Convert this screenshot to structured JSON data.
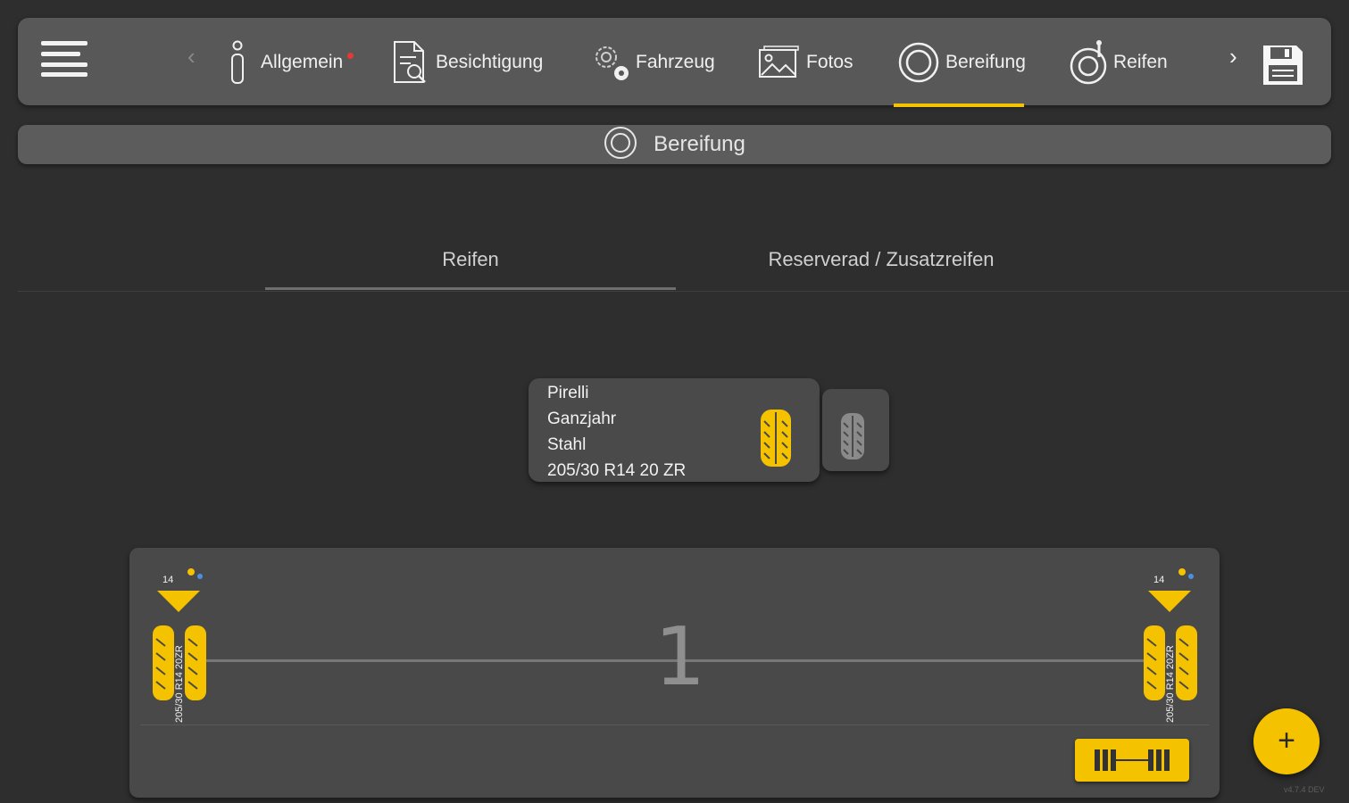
{
  "toolbar": {
    "tabs": [
      {
        "label": "Allgemein",
        "icon": "info-icon",
        "required": true
      },
      {
        "label": "Besichtigung",
        "icon": "document-search-icon"
      },
      {
        "label": "Fahrzeug",
        "icon": "gears-icon"
      },
      {
        "label": "Fotos",
        "icon": "photos-icon"
      },
      {
        "label": "Bereifung",
        "icon": "tire-ring-icon",
        "active": true
      },
      {
        "label": "Reifen",
        "icon": "tire-gauge-icon"
      }
    ],
    "prev": "‹",
    "next": "›",
    "accent_color": "#f5c200",
    "required_dot_color": "#e53935"
  },
  "section": {
    "title": "Bereifung"
  },
  "subtabs": [
    {
      "label": "Reifen",
      "active": true
    },
    {
      "label": "Reserverad / Zusatzreifen",
      "active": false
    }
  ],
  "tire_card": {
    "brand": "Pirelli",
    "season": "Ganzjahr",
    "rim": "Stahl",
    "size": "205/30 R14 20 ZR"
  },
  "axle": {
    "number": "1",
    "left_wheel": {
      "count": "14",
      "size": "205/30 R14 20ZR"
    },
    "right_wheel": {
      "count": "14",
      "size": "205/30 R14 20ZR"
    }
  },
  "fab": {
    "label": "+"
  },
  "version": "v4.7.4 DEV"
}
